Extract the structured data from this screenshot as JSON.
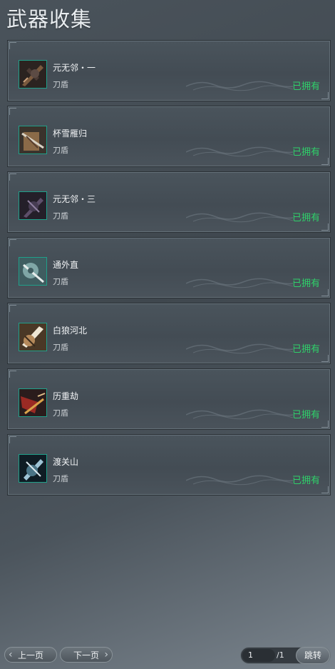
{
  "title": "武器收集",
  "weapons": [
    {
      "name": "元无邻・一",
      "type": "刀盾",
      "status": "已拥有",
      "icon": "weapon-yuan-wu-lin-1-icon"
    },
    {
      "name": "杯雪雁归",
      "type": "刀盾",
      "status": "已拥有",
      "icon": "weapon-bei-xue-yan-gui-icon"
    },
    {
      "name": "元无邻・三",
      "type": "刀盾",
      "status": "已拥有",
      "icon": "weapon-yuan-wu-lin-3-icon"
    },
    {
      "name": "通外直",
      "type": "刀盾",
      "status": "已拥有",
      "icon": "weapon-tong-wai-zhi-icon"
    },
    {
      "name": "白狼河北",
      "type": "刀盾",
      "status": "已拥有",
      "icon": "weapon-bai-lang-he-bei-icon"
    },
    {
      "name": "历重劫",
      "type": "刀盾",
      "status": "已拥有",
      "icon": "weapon-li-zhong-jie-icon"
    },
    {
      "name": "渡关山",
      "type": "刀盾",
      "status": "已拥有",
      "icon": "weapon-du-guan-shan-icon"
    }
  ],
  "pager": {
    "prev_label": "上一页",
    "next_label": "下一页",
    "current_page": "1",
    "total_pages": "/1",
    "jump_label": "跳转"
  },
  "colors": {
    "owned_status": "#2fd16a",
    "icon_border": "#1fa08a"
  }
}
